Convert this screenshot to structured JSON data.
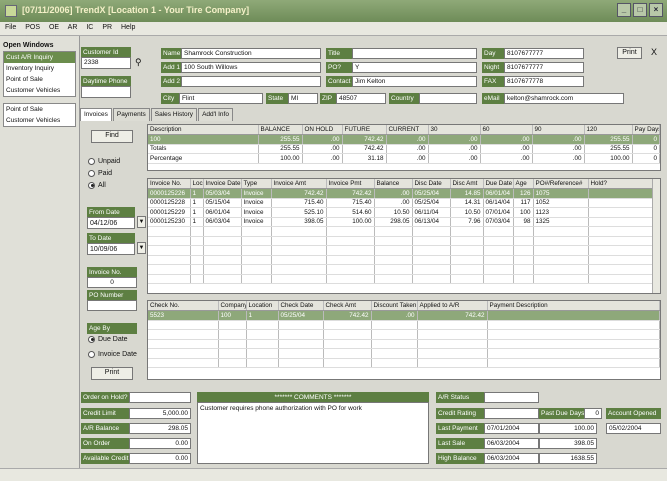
{
  "window": {
    "title": "[07/11/2006] TrendX [Location 1 - Your Tire Company]"
  },
  "menu": [
    "File",
    "POS",
    "OE",
    "AR",
    "IC",
    "PR",
    "Help"
  ],
  "sidebar": {
    "title": "Open Windows",
    "items": [
      "Cust A/R Inquiry",
      "Inventory Inquiry",
      "Point of Sale",
      "Customer Vehicles"
    ],
    "items2": [
      "Point of Sale",
      "Customer Vehicles"
    ]
  },
  "customer": {
    "id_label": "Customer Id",
    "id": "2338",
    "phone_label": "Daytime Phone",
    "phone": "",
    "name_label": "Name",
    "name": "Shamrock Construction",
    "add1_label": "Add 1",
    "add1": "100 South Willows",
    "add2_label": "Add 2",
    "add2": "",
    "city_label": "City",
    "city": "Flint",
    "state_label": "State",
    "state": "MI",
    "zip_label": "ZIP",
    "zip": "48507",
    "country_label": "Country",
    "country": "",
    "title_label": "Title",
    "title": "",
    "po_label": "PO?",
    "po": "Y",
    "contact_label": "Contact",
    "contact": "Jim Kelton",
    "day_label": "Day",
    "day": "8107677777",
    "night_label": "Night",
    "night": "8107677777",
    "fax_label": "FAX",
    "fax": "8107677778",
    "email_label": "eMail",
    "email": "kelton@shamrock.com"
  },
  "buttons": {
    "print": "Print",
    "close": "X",
    "find": "Find",
    "print2": "Print"
  },
  "tabs": [
    "Invoices",
    "Payments",
    "Sales History",
    "Add'l Info"
  ],
  "aging": {
    "headers": [
      "Description",
      "BALANCE",
      "ON HOLD",
      "FUTURE",
      "CURRENT",
      "30",
      "60",
      "90",
      "120",
      "Pay Days"
    ],
    "rows": [
      [
        "100",
        "255.55",
        ".00",
        "742.42",
        ".00",
        ".00",
        ".00",
        ".00",
        "255.55",
        "0"
      ],
      [
        "Totals",
        "255.55",
        ".00",
        "742.42",
        ".00",
        ".00",
        ".00",
        ".00",
        "255.55",
        "0"
      ],
      [
        "Percentage",
        "100.00",
        ".00",
        "31.18",
        ".00",
        ".00",
        ".00",
        ".00",
        "100.00",
        "0"
      ]
    ]
  },
  "filters": {
    "unpaid": "Unpaid",
    "paid": "Paid",
    "all": "All",
    "from_label": "From Date",
    "from": "04/12/06",
    "to_label": "To Date",
    "to": "10/09/06",
    "invno_label": "Invoice No.",
    "invno": "0",
    "po_label": "PO Number",
    "po": "",
    "age_label": "Age By",
    "due": "Due Date",
    "invdate": "Invoice Date"
  },
  "invoices": {
    "headers": [
      "Invoice No.",
      "Loc",
      "Invoice Date",
      "Type",
      "Invoice Amt",
      "Invoice Pmt",
      "Balance",
      "Disc Date",
      "Disc Amt",
      "Due Date",
      "Age",
      "PO#/Reference#",
      "Hold?"
    ],
    "rows": [
      [
        "0000125226",
        "1",
        "05/03/04",
        "Invoice",
        "742.42",
        "742.42",
        ".00",
        "05/25/04",
        "14.85",
        "06/01/04",
        "126",
        "1075",
        ""
      ],
      [
        "0000125228",
        "1",
        "05/15/04",
        "Invoice",
        "715.40",
        "715.40",
        ".00",
        "05/25/04",
        "14.31",
        "06/14/04",
        "117",
        "1052",
        ""
      ],
      [
        "0000125229",
        "1",
        "06/01/04",
        "Invoice",
        "525.10",
        "514.60",
        "10.50",
        "06/11/04",
        "10.50",
        "07/01/04",
        "100",
        "1123",
        ""
      ],
      [
        "0000125230",
        "1",
        "06/03/04",
        "Invoice",
        "398.05",
        "100.00",
        "298.05",
        "06/13/04",
        "7.96",
        "07/03/04",
        "98",
        "1325",
        ""
      ]
    ]
  },
  "payments": {
    "headers": [
      "Check No.",
      "Company",
      "Location",
      "Check Date",
      "Check Amt",
      "Discount Taken",
      "Applied to A/R",
      "Payment Description"
    ],
    "rows": [
      [
        "5523",
        "100",
        "1",
        "05/25/04",
        "742.42",
        ".00",
        "742.42",
        ""
      ]
    ]
  },
  "summary": {
    "hold_label": "Order on Hold?",
    "hold": "",
    "credit_label": "Credit Limit",
    "credit": "5,000.00",
    "ar_label": "A/R Balance",
    "ar": "298.05",
    "onorder_label": "On Order",
    "onorder": "0.00",
    "avail_label": "Available Credit",
    "avail": "0.00",
    "comments_label": "******* COMMENTS *******",
    "comments": "Customer requires phone authorization with PO for work",
    "arstatus_label": "A/R Status",
    "arstatus": "",
    "rating_label": "Credit Rating",
    "rating": "",
    "lastpay_label": "Last Payment",
    "lastpay_date": "07/01/2004",
    "lastpay": "100.00",
    "lastsale_label": "Last Sale",
    "lastsale_date": "06/03/2004",
    "lastsale": "398.05",
    "high_label": "High Balance",
    "high_date": "06/03/2004",
    "high": "1638.55",
    "pastdue_label": "Past Due Days",
    "pastdue": "0",
    "opened_label": "Account Opened",
    "opened": "05/02/2004"
  }
}
